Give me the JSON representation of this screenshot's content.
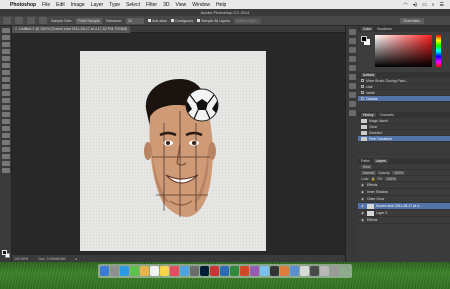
{
  "menubar": {
    "app_name": "Photoshop",
    "items": [
      "File",
      "Edit",
      "Image",
      "Layer",
      "Type",
      "Select",
      "Filter",
      "3D",
      "View",
      "Window",
      "Help"
    ]
  },
  "window": {
    "title": "Adobe Photoshop CC 2014"
  },
  "options_bar": {
    "sample_size_label": "Sample Size:",
    "sample_size_value": "Point Sample",
    "tolerance_label": "Tolerance:",
    "tolerance_value": "32",
    "anti_alias": "Anti-alias",
    "contiguous": "Contiguous",
    "sample_all_layers": "Sample All Layers",
    "refine_edge": "Refine Edge...",
    "workspace": "Essentials"
  },
  "document": {
    "tab_title": "Untitled-1 @ 100% (Screen shot 2011-08-17 at 4.17.52 PM, RGB/8)",
    "zoom": "100.00%",
    "doc_size": "Doc: 3.00M/9.8M"
  },
  "panels": {
    "color_tabs": [
      "Color",
      "Swatches"
    ],
    "actions_tab": "Actions",
    "actions": [
      {
        "label": "Mixer Brush Cloning Paint..."
      },
      {
        "label": "chat"
      },
      {
        "label": "inside"
      },
      {
        "label": "Outside"
      }
    ],
    "history_tabs": [
      "History",
      "Channels"
    ],
    "history": [
      {
        "label": "Magic Wand"
      },
      {
        "label": "Clear"
      },
      {
        "label": "Deselect"
      },
      {
        "label": "Free Transform"
      }
    ],
    "layers_tabs": [
      "Paths",
      "Layers"
    ],
    "layers_kind": "Kind",
    "layers_mode": "Normal",
    "opacity_label": "Opacity:",
    "opacity_value": "100%",
    "lock_label": "Lock:",
    "fill_label": "Fill:",
    "fill_value": "100%",
    "layers": [
      {
        "label": "Effects"
      },
      {
        "label": "Inner Shadow"
      },
      {
        "label": "Outer Glow"
      },
      {
        "label": "Screen shot 2011-08-17 at 4..."
      },
      {
        "label": "Layer 3"
      },
      {
        "label": "Effects"
      }
    ]
  },
  "colors": {
    "selection": "#5274a8",
    "panel": "#3d3d3d",
    "canvas_bg": "#e6e6e4"
  }
}
